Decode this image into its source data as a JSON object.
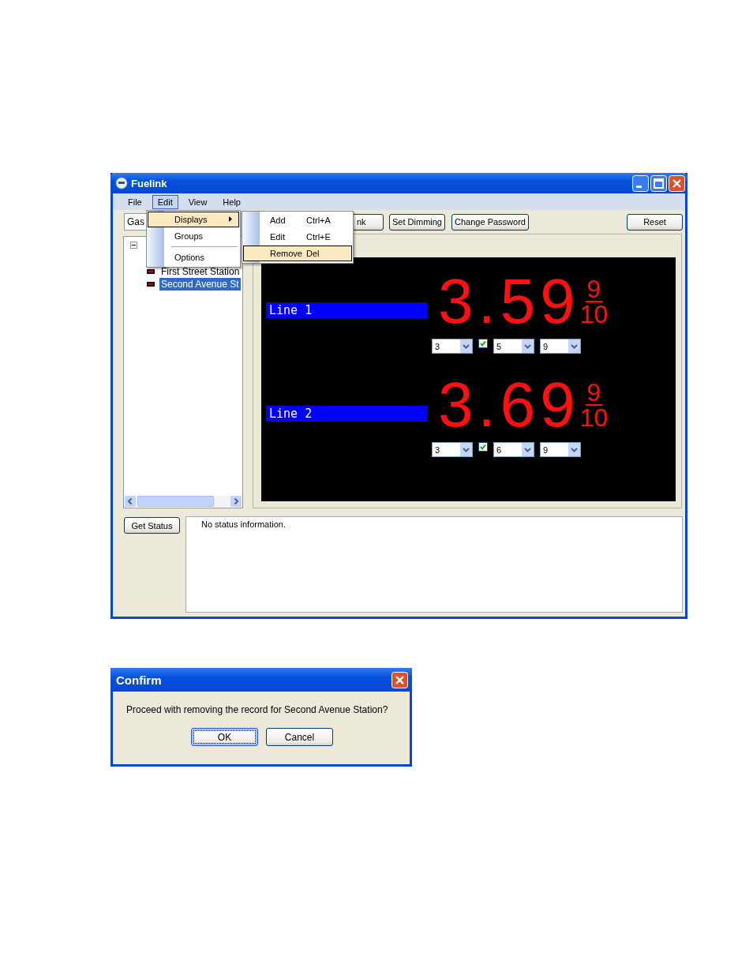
{
  "window": {
    "title": "Fuelink"
  },
  "menu_bar": [
    {
      "label": "File",
      "selected": false
    },
    {
      "label": "Edit",
      "selected": true
    },
    {
      "label": "View",
      "selected": false
    },
    {
      "label": "Help",
      "selected": false
    }
  ],
  "edit_menu": [
    {
      "kind": "submenu",
      "label": "Displays",
      "selected": true
    },
    {
      "kind": "item",
      "label": "Groups",
      "selected": false
    },
    {
      "kind": "separator"
    },
    {
      "kind": "item",
      "label": "Options",
      "selected": false
    }
  ],
  "displays_submenu": [
    {
      "label": "Add",
      "shortcut": "Ctrl+A",
      "selected": false
    },
    {
      "label": "Edit",
      "shortcut": "Ctrl+E",
      "selected": false
    },
    {
      "label": "Remove",
      "shortcut": "Del",
      "selected": true
    }
  ],
  "toolbar": {
    "combo": {
      "value": "Gas"
    },
    "buttons": [
      "nk",
      "Set Dimming",
      "Change Password"
    ],
    "reset": "Reset"
  },
  "tree": {
    "expanded": true,
    "children": [
      {
        "label": "First Street Station",
        "selected": false
      },
      {
        "label": "Second Avenue St",
        "selected": true
      }
    ]
  },
  "lines": [
    {
      "label": "Line 1",
      "price": "3.59",
      "numerator": "9",
      "denominator": "10",
      "checked": true,
      "selects": [
        "3",
        "5",
        "9"
      ]
    },
    {
      "label": "Line 2",
      "price": "3.69",
      "numerator": "9",
      "denominator": "10",
      "checked": true,
      "selects": [
        "3",
        "6",
        "9"
      ]
    }
  ],
  "status": {
    "button": "Get Status",
    "text": "No status information."
  },
  "confirm": {
    "title": "Confirm",
    "message": "Proceed with removing the record for Second Avenue Station?",
    "buttons": [
      {
        "label": "OK",
        "focused": true
      },
      {
        "label": "Cancel",
        "focused": false
      }
    ]
  }
}
